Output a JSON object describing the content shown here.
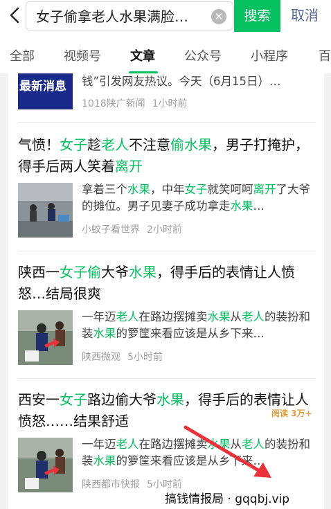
{
  "header": {
    "query": "女子偷拿老人水果满脸…",
    "search_label": "搜索",
    "cancel_label": "取消"
  },
  "tabs": [
    "全部",
    "视频号",
    "文章",
    "公众号",
    "小程序",
    "百"
  ],
  "items": [
    {
      "thumb_text": "最新消息",
      "snippet": "钱”引发网友热议。今天（6月15日）…",
      "source": "1018陕广新闻",
      "time": "1小时前"
    },
    {
      "title": [
        {
          "t": "气愤！"
        },
        {
          "t": "女子",
          "h": 1
        },
        {
          "t": "趁"
        },
        {
          "t": "老人",
          "h": 1
        },
        {
          "t": "不注意"
        },
        {
          "t": "偷水果",
          "h": 1
        },
        {
          "t": "，男子打掩护，得手后两人笑着"
        },
        {
          "t": "离开",
          "h": 1
        }
      ],
      "snippet": [
        {
          "t": "拿着三个"
        },
        {
          "t": "水果",
          "h": 1
        },
        {
          "t": "，中年"
        },
        {
          "t": "女子",
          "h": 1
        },
        {
          "t": "就笑呵呵"
        },
        {
          "t": "离开",
          "h": 1
        },
        {
          "t": "了大爷的摊位。男子见妻子成功拿走"
        },
        {
          "t": "水果",
          "h": 1
        },
        {
          "t": "…"
        }
      ],
      "source": "小蚊子看世界",
      "time": "2小时前"
    },
    {
      "title": [
        {
          "t": "陕西一"
        },
        {
          "t": "女子",
          "h": 1
        },
        {
          "t": "偷",
          "h": 1
        },
        {
          "t": "大爷"
        },
        {
          "t": "水果",
          "h": 1
        },
        {
          "t": "，得手后的表情让人愤怒…结局很爽"
        }
      ],
      "snippet": [
        {
          "t": "一年迈"
        },
        {
          "t": "老人",
          "h": 1
        },
        {
          "t": "在路边摆摊卖"
        },
        {
          "t": "水果",
          "h": 1
        },
        {
          "t": "从"
        },
        {
          "t": "老人",
          "h": 1
        },
        {
          "t": "的装扮和装"
        },
        {
          "t": "水果",
          "h": 1
        },
        {
          "t": "的箩筐来看应该是从乡下来…"
        }
      ],
      "source": "陕西微观",
      "time": "5小时前"
    },
    {
      "title": [
        {
          "t": "西安一"
        },
        {
          "t": "女子",
          "h": 1
        },
        {
          "t": "路边偷大爷"
        },
        {
          "t": "水果",
          "h": 1
        },
        {
          "t": "，得手后的表情让人愤怒……结果舒适"
        }
      ],
      "snippet": [
        {
          "t": "一年迈"
        },
        {
          "t": "老人",
          "h": 1
        },
        {
          "t": "在路边摆摊卖"
        },
        {
          "t": "水果",
          "h": 1
        },
        {
          "t": "从"
        },
        {
          "t": "老人",
          "h": 1
        },
        {
          "t": "的装扮和装"
        },
        {
          "t": "水果",
          "h": 1
        },
        {
          "t": "的箩筐来看应该是从乡下来…"
        }
      ],
      "source": "陕西都市快报",
      "time": "5小时前"
    }
  ],
  "reads": "阅读 3万+",
  "watermark": "搞钱情报局 · gqqbj.vip",
  "colors": {
    "accent": "#07c160",
    "link_blue": "#576b95",
    "thumb_navy": "#1a2a8a",
    "red_arrow": "#e8333a"
  }
}
